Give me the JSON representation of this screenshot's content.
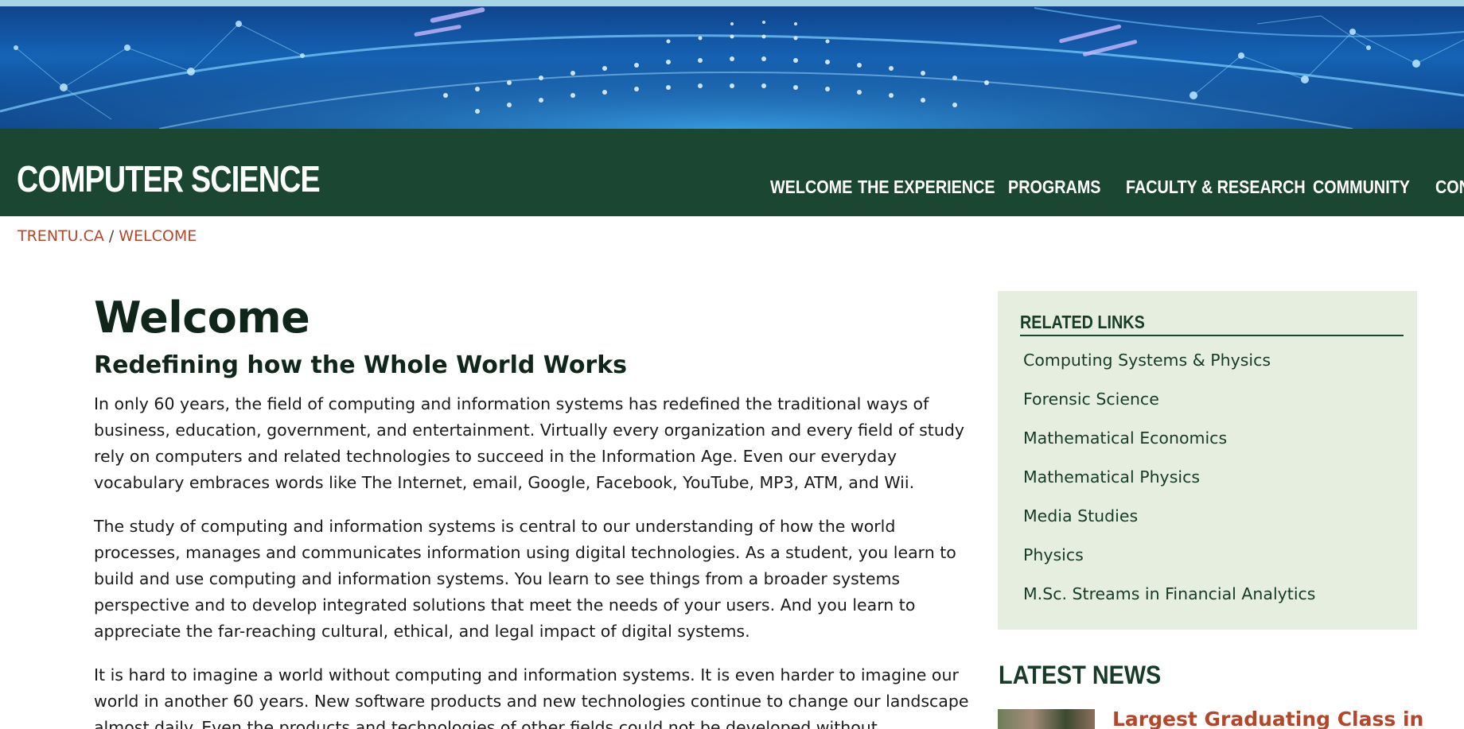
{
  "banner": {
    "name": "network-globe-banner"
  },
  "header": {
    "site_title": "COMPUTER SCIENCE",
    "nav": [
      "WELCOME",
      "THE EXPERIENCE",
      "PROGRAMS",
      "FACULTY & RESEARCH",
      "COMMUNITY",
      "CONT"
    ]
  },
  "breadcrumb": {
    "home": "TRENTU.CA",
    "separator": "/",
    "current": "WELCOME"
  },
  "main": {
    "title": "Welcome",
    "subtitle": "Redefining how the Whole World Works",
    "paragraphs": [
      "In only 60 years, the field of computing and information systems has redefined the traditional ways of business, education, government, and entertainment.  Virtually every organization and every field of study rely on computers and related technologies to succeed in the Information Age.  Even our everyday vocabulary embraces words like The Internet, email, Google, Facebook, YouTube, MP3, ATM, and Wii.",
      "The study of computing and information systems is central to our understanding of how the world processes, manages and communicates information using digital technologies.  As a student, you learn to build and use computing and information systems.  You learn to see things from a broader systems perspective and to develop integrated solutions that meet the needs of your users.  And you learn to appreciate the far-reaching cultural, ethical, and legal impact of digital systems.",
      "It is hard to imagine a world without computing and information systems.  It is even harder to imagine our world in another 60 years.  New software products and new technologies continue to change our landscape almost daily.  Even the products and technologies of other fields could not be developed without"
    ]
  },
  "sidebar": {
    "related_heading": "RELATED LINKS",
    "links": [
      "Computing Systems & Physics",
      "Forensic Science",
      "Mathematical Economics",
      "Mathematical Physics",
      "Media Studies",
      "Physics",
      "M.Sc. Streams in Financial Analytics"
    ],
    "news_heading": "LATEST NEWS",
    "news_item_title": "Largest Graduating Class in"
  },
  "colors": {
    "header_green": "#1b4631",
    "link_red": "#b4472a",
    "sidebar_bg": "#e6efdf"
  }
}
